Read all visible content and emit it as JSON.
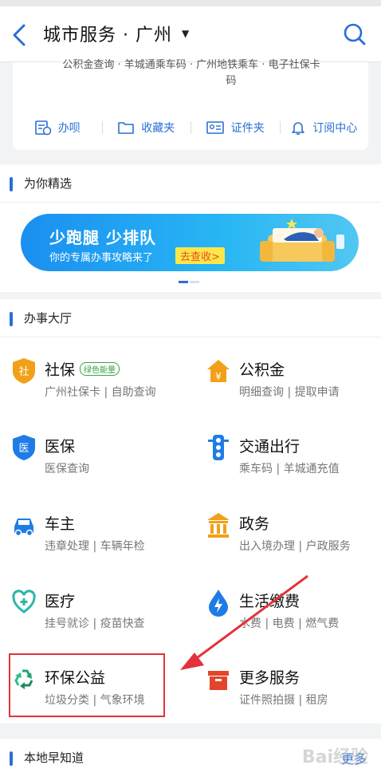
{
  "header": {
    "title": "城市服务 · 广州",
    "caret": "▼"
  },
  "card": {
    "cut_text": "公积金查询 · 羊城通乘车码 · 广州地铁乘车 · 电子社保卡",
    "cut_text2": "码",
    "quick": [
      {
        "label": "办呗",
        "icon": "calendar-clock-icon"
      },
      {
        "label": "收藏夹",
        "icon": "folder-icon"
      },
      {
        "label": "证件夹",
        "icon": "id-card-icon"
      },
      {
        "label": "订阅中心",
        "icon": "bell-icon"
      }
    ]
  },
  "picks": {
    "title": "为你精选",
    "banner_title": "少跑腿 少排队",
    "banner_sub": "你的专属办事攻略来了",
    "banner_btn": "去查收>"
  },
  "hall": {
    "title": "办事大厅",
    "services": [
      {
        "name": "社保",
        "sub": "广州社保卡 | 自助查询",
        "badge": "绿色能量",
        "icon": "shield-badge-icon"
      },
      {
        "name": "公积金",
        "sub": "明细查询 | 提取申请",
        "badge": "",
        "icon": "house-coin-icon"
      },
      {
        "name": "医保",
        "sub": "医保查询",
        "badge": "",
        "icon": "medical-shield-icon"
      },
      {
        "name": "交通出行",
        "sub": "乘车码 | 羊城通充值",
        "badge": "",
        "icon": "traffic-light-icon"
      },
      {
        "name": "车主",
        "sub": "违章处理 | 车辆年检",
        "badge": "",
        "icon": "car-icon"
      },
      {
        "name": "政务",
        "sub": "出入境办理 | 户政服务",
        "badge": "",
        "icon": "government-building-icon"
      },
      {
        "name": "医疗",
        "sub": "挂号就诊 | 疫苗快查",
        "badge": "",
        "icon": "stethoscope-heart-icon"
      },
      {
        "name": "生活缴费",
        "sub": "水费 | 电费 | 燃气费",
        "badge": "",
        "icon": "lightning-drop-icon"
      },
      {
        "name": "环保公益",
        "sub": "垃圾分类 | 气象环境",
        "badge": "",
        "icon": "recycle-icon"
      },
      {
        "name": "更多服务",
        "sub": "证件照拍摄 | 租房",
        "badge": "",
        "icon": "box-icon"
      }
    ]
  },
  "local": {
    "title": "本地早知道",
    "more": "更多"
  },
  "watermark": "Bai经验"
}
